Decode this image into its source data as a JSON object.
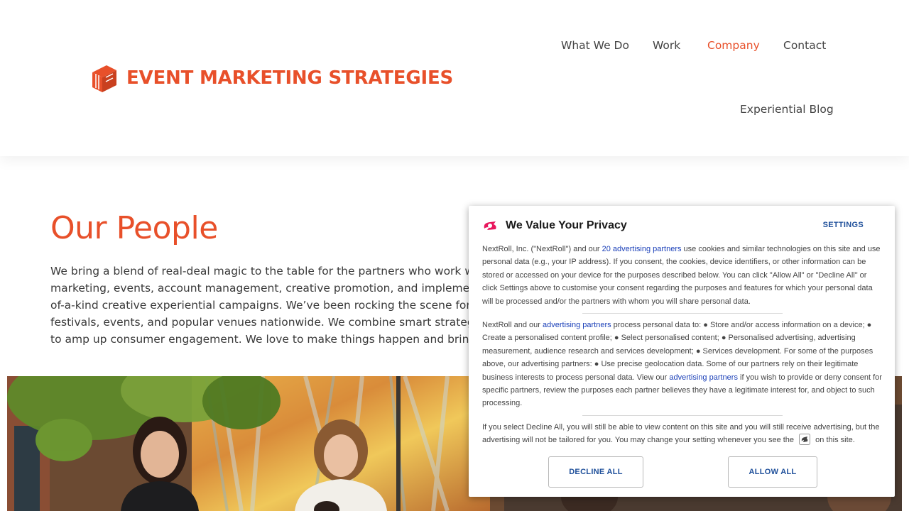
{
  "header": {
    "logo_text": "EVENT MARKETING STRATEGIES",
    "nav": [
      {
        "label": "What We Do",
        "active": false
      },
      {
        "label": "Work",
        "active": false
      },
      {
        "label": "Company",
        "active": true
      },
      {
        "label": "Contact",
        "active": false
      },
      {
        "label": "Experiential Blog",
        "active": false
      }
    ]
  },
  "main": {
    "title": "Our People",
    "intro_lines": [
      "We bring a blend of real-deal magic to the table for the partners who work with",
      "marketing, events, account management, creative promotion, and implementatio",
      "of-a-kind creative experiential campaigns. We’ve been rocking the scene for over",
      "festivals, events, and popular venues nationwide. We combine smart strategy, cre",
      "to amp up consumer engagement. We love to make things happen and bring our c"
    ]
  },
  "consent": {
    "title": "We Value Your Privacy",
    "settings_label": "SETTINGS",
    "p1_pre": "NextRoll, Inc. (\"NextRoll\") and our ",
    "p1_link": "20 advertising partners",
    "p1_post": " use cookies and similar technologies on this site and use personal data (e.g., your IP address). If you consent, the cookies, device identifiers, or other information can be stored or accessed on your device for the purposes described below. You can click \"Allow All\" or \"Decline All\" or click Settings above to customise your consent regarding the purposes and features for which your personal data will be processed and/or the partners with whom you will share personal data.",
    "p2_pre": "NextRoll and our ",
    "p2_link1": "advertising partners",
    "p2_mid": " process personal data to: ● Store and/or access information on a device; ● Create a personalised content profile; ● Select personalised content; ● Personalised advertising, advertising measurement, audience research and services development; ● Services development. For some of the purposes above, our advertising partners: ● Use precise geolocation data. Some of our partners rely on their legitimate business interests to process personal data. View our ",
    "p2_link2": "advertising partners",
    "p2_post": " if you wish to provide or deny consent for specific partners, review the purposes each partner believes they have a legitimate interest for, and object to such processing.",
    "p3_pre": "If you select Decline All, you will still be able to view content on this site and you will still receive advertising, but the advertising will not be tailored for you. You may change your setting whenever you see the ",
    "p3_post": " on this site.",
    "decline_label": "DECLINE ALL",
    "allow_label": "ALLOW ALL"
  },
  "colors": {
    "brand": "#e8502a",
    "consent_link": "#1a3fb8",
    "consent_button_text": "#1e4f9a",
    "nextroll_pink": "#e8175d"
  }
}
